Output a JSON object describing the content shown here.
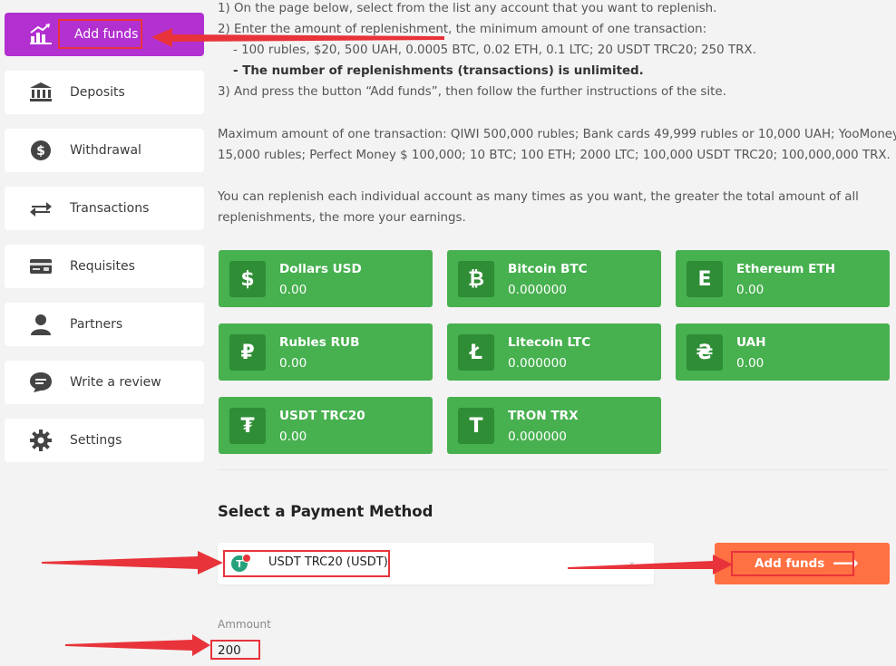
{
  "sidebar": {
    "items": [
      {
        "label": "Add funds",
        "icon": "chart-up-icon"
      },
      {
        "label": "Deposits",
        "icon": "bank-icon"
      },
      {
        "label": "Withdrawal",
        "icon": "dollar-coin-icon"
      },
      {
        "label": "Transactions",
        "icon": "exchange-arrows-icon"
      },
      {
        "label": "Requisites",
        "icon": "credit-card-icon"
      },
      {
        "label": "Partners",
        "icon": "user-icon"
      },
      {
        "label": "Write a review",
        "icon": "chat-bubble-icon"
      },
      {
        "label": "Settings",
        "icon": "gear-icon"
      }
    ]
  },
  "instructions": {
    "step1": "1) On the page below, select from the list any account that you want to replenish.",
    "step2": "2) Enter the amount of replenishment, the minimum amount of one transaction:",
    "step2_min": "- 100 rubles, $20, 500 UAH, 0.0005 BTC, 0.02 ETH, 0.1 LTC; 20 USDT TRC20; 250 TRX.",
    "step2_unlimited": "- The number of replenishments (transactions) is unlimited.",
    "step3": "3) And press the button “Add funds”, then follow the further instructions of the site.",
    "max_line1": "Maximum amount of one transaction: QIWI 500,000 rubles; Bank cards 49,999 rubles or 10,000 UAH; YooMoney",
    "max_line2": "15,000 rubles; Perfect Money $ 100,000; 10 BTC; 100 ETH; 2000 LTC; 100,000 USDT TRC20; 100,000,000 TRX.",
    "replenish_line1": "You can replenish each individual account as many times as you want, the greater the total amount of all",
    "replenish_line2": "replenishments, the more your earnings."
  },
  "accounts": [
    {
      "symbol": "$",
      "name": "Dollars USD",
      "value": "0.00"
    },
    {
      "symbol": "₿",
      "name": "Bitcoin BTC",
      "value": "0.000000"
    },
    {
      "symbol": "E",
      "name": "Ethereum ETH",
      "value": "0.00"
    },
    {
      "symbol": "₽",
      "name": "Rubles RUB",
      "value": "0.00"
    },
    {
      "symbol": "Ł",
      "name": "Litecoin LTC",
      "value": "0.000000"
    },
    {
      "symbol": "₴",
      "name": "UAH",
      "value": "0.00"
    },
    {
      "symbol": "₮",
      "name": "USDT TRC20",
      "value": "0.00"
    },
    {
      "symbol": "T",
      "name": "TRON TRX",
      "value": "0.000000"
    }
  ],
  "payment": {
    "title": "Select a Payment Method",
    "selected": "USDT TRC20 (USDT)",
    "icon": "tether-icon",
    "button_label": "Add funds",
    "amount_label": "Ammount",
    "amount_value": "200"
  },
  "colors": {
    "active_nav": "#b22fd0",
    "card_green": "#47b04f",
    "button_orange": "#ff7043",
    "annotation_red": "#e8333a"
  }
}
